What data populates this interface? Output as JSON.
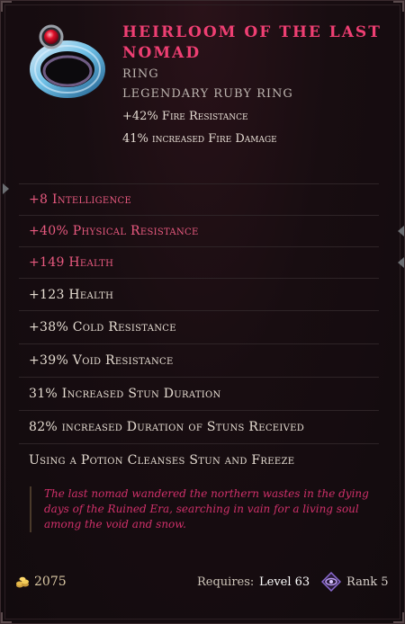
{
  "item": {
    "name": "Heirloom of the Last Nomad",
    "subtype": "Ring",
    "base_type": "Legendary Ruby Ring",
    "implicits": [
      "+42% Fire Resistance",
      "41% increased Fire Damage"
    ],
    "affixes": [
      "+8 Intelligence",
      "+40% Physical Resistance",
      "+149 Health",
      "+123 Health",
      "+38% Cold Resistance",
      "+39% Void Resistance",
      "31% Increased Stun Duration",
      "82% increased Duration of Stuns Received",
      "Using a Potion Cleanses Stun and Freeze"
    ],
    "lore": "The last nomad wandered the northern wastes in the dying days of the Ruined Era, searching in vain for a living soul among the void and snow."
  },
  "footer": {
    "gold": "2075",
    "requires_label": "Requires:",
    "requires_value": "Level 63",
    "rank": "Rank 5"
  },
  "icons": {
    "item": "ruby-ring-icon",
    "gold": "gold-coins-icon",
    "rank": "rank-eye-icon"
  },
  "colors": {
    "title": "#ef3f73",
    "sealed_affix": "#ea5a80",
    "affix": "#e6ddd2",
    "lore": "#d0306a",
    "background": "#180d11"
  }
}
